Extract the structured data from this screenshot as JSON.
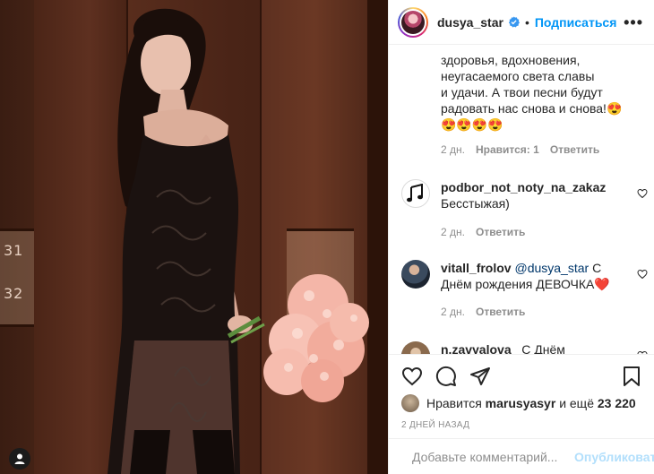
{
  "post": {
    "username": "dusya_star",
    "verified": true,
    "follow_label": "Подписаться",
    "separator": "•",
    "more_label": "•••"
  },
  "photo": {
    "door_numbers": [
      "31",
      "32"
    ]
  },
  "comments": {
    "continued": {
      "lines": [
        "здоровья, вдохновения,",
        "неугасаемого света славы",
        "и удачи. А твои песни будут",
        "радовать нас снова и снова!😍",
        "😍😍😍😍"
      ],
      "time": "2 дн.",
      "likes": "Нравится: 1",
      "reply": "Ответить"
    },
    "items": [
      {
        "username": "podbor_not_noty_na_zakaz",
        "text": "Бесстыжая)",
        "time": "2 дн.",
        "reply": "Ответить",
        "avatar_icon": "music-note-icon"
      },
      {
        "username": "vitall_frolov",
        "mention": "@dusya_star",
        "text": " С Днём рождения ДЕВОЧКА",
        "emoji": "❤️",
        "time": "2 дн.",
        "reply": "Ответить"
      },
      {
        "username": "n.zavyalova_",
        "text": "С Днём Рождения!",
        "emoji": "❤️❤️❤️"
      }
    ]
  },
  "actions": {
    "like_icon": "heart-icon",
    "comment_icon": "comment-icon",
    "share_icon": "share-icon",
    "save_icon": "bookmark-icon"
  },
  "likes": {
    "prefix": "Нравится",
    "user": "marusyasyr",
    "middle": "и ещё",
    "count": "23 220"
  },
  "date": "2 ДНЕЙ НАЗАД",
  "add_comment": {
    "placeholder": "Добавьте комментарий...",
    "publish_label": "Опубликовать"
  },
  "colors": {
    "accent": "#0095f6",
    "publish_disabled": "#b2dffc",
    "muted": "#8e8e8e"
  }
}
